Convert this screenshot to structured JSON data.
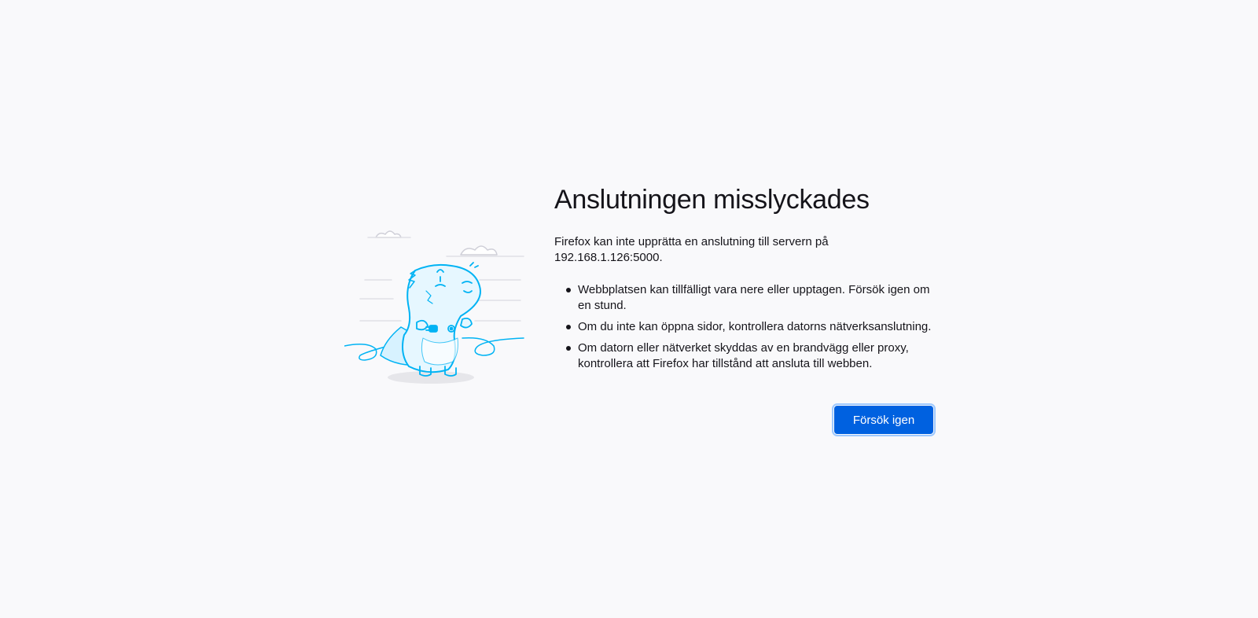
{
  "error_page": {
    "title": "Anslutningen misslyckades",
    "description": "Firefox kan inte upprätta en anslutning till servern på 192.168.1.126:5000.",
    "tips": [
      "Webbplatsen kan tillfälligt vara nere eller upptagen. Försök igen om en stund.",
      "Om du inte kan öppna sidor, kontrollera datorns nätverksanslutning.",
      "Om datorn eller nätverket skyddas av en brandvägg eller proxy, kontrollera att Firefox har tillstånd att ansluta till webben."
    ],
    "retry_label": "Försök igen"
  },
  "illustration": {
    "icon": "unplugged-dino-illustration",
    "color": "#00b3f4"
  },
  "colors": {
    "background": "#f9f9fb",
    "text": "#15141a",
    "button": "#0061e0",
    "button_focus_ring": "#9ec9ff"
  }
}
